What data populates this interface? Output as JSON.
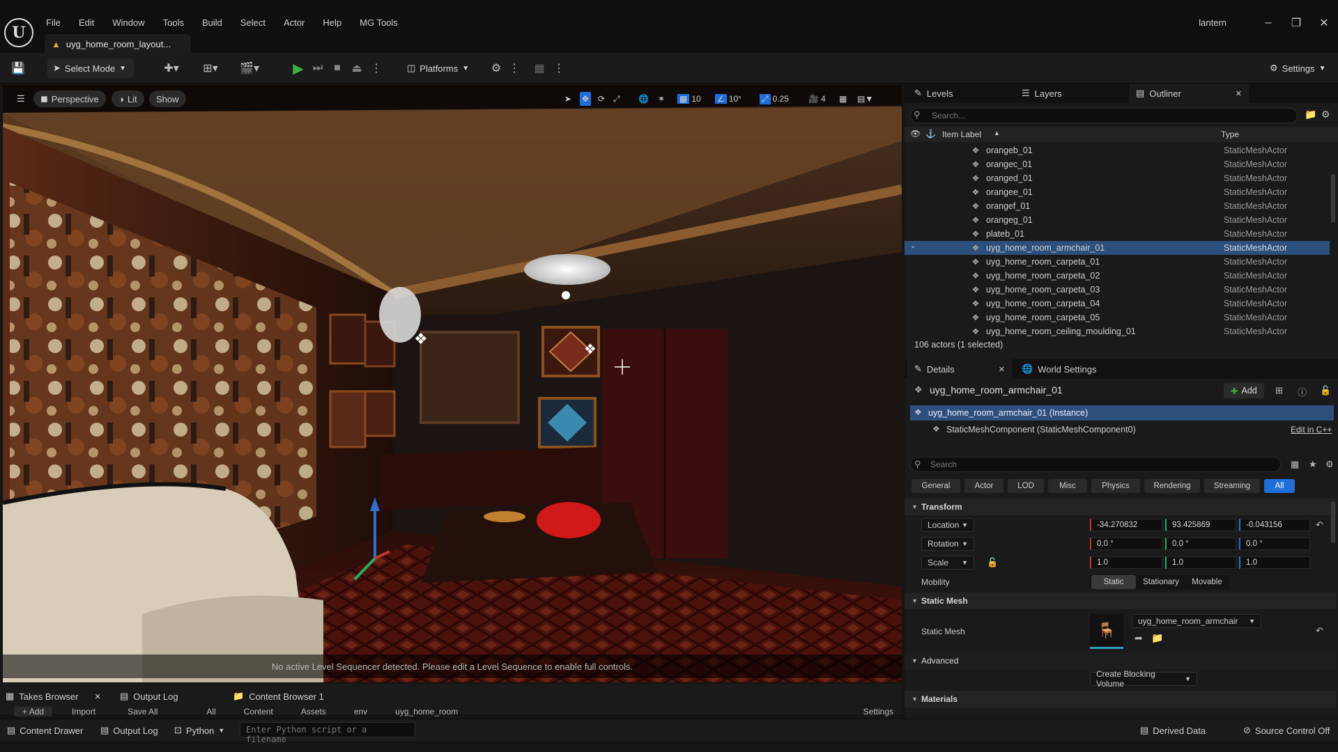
{
  "app": {
    "logo": "U",
    "user": "lantern"
  },
  "menu": [
    "File",
    "Edit",
    "Window",
    "Tools",
    "Build",
    "Select",
    "Actor",
    "Help",
    "MG Tools"
  ],
  "document_tab": "uyg_home_room_layout...",
  "toolbar": {
    "select_mode": "Select Mode",
    "platforms": "Platforms",
    "settings": "Settings"
  },
  "viewport": {
    "perspective": "Perspective",
    "lit": "Lit",
    "show": "Show",
    "grid_snap": "10",
    "rotation_snap": "10°",
    "scale_snap": "0.25",
    "camera_speed": "4",
    "sequencer_message": "No active Level Sequencer detected. Please edit a Level Sequence to enable full controls."
  },
  "bottom_tabs": {
    "takes": "Takes Browser",
    "output_log": "Output Log",
    "content_browser": "Content Browser 1"
  },
  "content_toolbar": {
    "add": "Add",
    "import": "Import",
    "save_all": "Save All",
    "settings": "Settings"
  },
  "breadcrumb": [
    "All",
    "Content",
    "Assets",
    "env",
    "uyg_home_room"
  ],
  "statusbar": {
    "content_drawer": "Content Drawer",
    "output_log": "Output Log",
    "python": "Python",
    "python_placeholder": "Enter Python script or a filename",
    "derived_data": "Derived Data",
    "source_control": "Source Control Off"
  },
  "outliner": {
    "tabs": {
      "levels": "Levels",
      "layers": "Layers",
      "outliner": "Outliner"
    },
    "search_placeholder": "Search...",
    "col_label": "Item Label",
    "col_type": "Type",
    "rows": [
      {
        "name": "orangeb_01",
        "type": "StaticMeshActor"
      },
      {
        "name": "orangec_01",
        "type": "StaticMeshActor"
      },
      {
        "name": "oranged_01",
        "type": "StaticMeshActor"
      },
      {
        "name": "orangee_01",
        "type": "StaticMeshActor"
      },
      {
        "name": "orangef_01",
        "type": "StaticMeshActor"
      },
      {
        "name": "orangeg_01",
        "type": "StaticMeshActor"
      },
      {
        "name": "plateb_01",
        "type": "StaticMeshActor"
      },
      {
        "name": "uyg_home_room_armchair_01",
        "type": "StaticMeshActor",
        "selected": true
      },
      {
        "name": "uyg_home_room_carpeta_01",
        "type": "StaticMeshActor"
      },
      {
        "name": "uyg_home_room_carpeta_02",
        "type": "StaticMeshActor"
      },
      {
        "name": "uyg_home_room_carpeta_03",
        "type": "StaticMeshActor"
      },
      {
        "name": "uyg_home_room_carpeta_04",
        "type": "StaticMeshActor"
      },
      {
        "name": "uyg_home_room_carpeta_05",
        "type": "StaticMeshActor"
      },
      {
        "name": "uyg_home_room_ceiling_moulding_01",
        "type": "StaticMeshActor"
      }
    ],
    "actor_count": "106 actors (1 selected)"
  },
  "details": {
    "tabs": {
      "details": "Details",
      "world_settings": "World Settings"
    },
    "actor_name": "uyg_home_room_armchair_01",
    "add_label": "Add",
    "instance": "uyg_home_room_armchair_01 (Instance)",
    "component": "StaticMeshComponent (StaticMeshComponent0)",
    "edit_cpp": "Edit in C++",
    "search_placeholder": "Search",
    "categories": [
      "General",
      "Actor",
      "LOD",
      "Misc",
      "Physics",
      "Rendering",
      "Streaming",
      "All"
    ],
    "transform_title": "Transform",
    "location_label": "Location",
    "location": [
      "-34.270832",
      "93.425869",
      "-0.043156"
    ],
    "rotation_label": "Rotation",
    "rotation": [
      "0.0 °",
      "0.0 °",
      "0.0 °"
    ],
    "scale_label": "Scale",
    "scale": [
      "1.0",
      "1.0",
      "1.0"
    ],
    "mobility_label": "Mobility",
    "mobility": [
      "Static",
      "Stationary",
      "Movable"
    ],
    "static_mesh_title": "Static Mesh",
    "static_mesh_label": "Static Mesh",
    "static_mesh_value": "uyg_home_room_armchair",
    "advanced_title": "Advanced",
    "blocking_volume": "Create Blocking Volume",
    "materials_title": "Materials"
  },
  "colors": {
    "accent": "#1e6fd9",
    "selection": "#2d4f7c",
    "play": "#3cb043"
  }
}
